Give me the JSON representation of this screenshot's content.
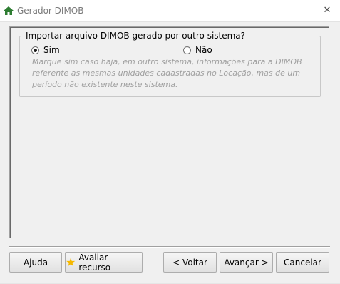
{
  "window": {
    "title": "Gerador DIMOB",
    "close_symbol": "✕"
  },
  "group": {
    "legend": "Importar arquivo DIMOB gerado por outro sistema?",
    "options": [
      {
        "label": "Sim",
        "checked": true
      },
      {
        "label": "Não",
        "checked": false
      }
    ],
    "hint": "Marque sim caso haja, em outro sistema, informações para a DIMOB referente as mesmas unidades cadastradas no Locação, mas de um período não existente neste sistema."
  },
  "buttons": {
    "help": "Ajuda",
    "rate": "Avaliar recurso",
    "back": "< Voltar",
    "next": "Avançar >",
    "cancel": "Cancelar"
  },
  "icons": {
    "title_icon": "home-icon",
    "rate_icon": "star-icon"
  },
  "colors": {
    "home_icon": "#2e7d32",
    "star": "#f5b800",
    "hint_text": "#a0a0a0"
  }
}
